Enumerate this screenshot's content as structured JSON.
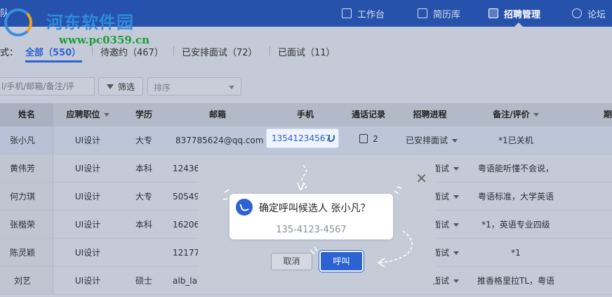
{
  "header": {
    "team_label": "队",
    "nav": [
      {
        "label": "工作台",
        "icon": "dashboard-icon",
        "active": false
      },
      {
        "label": "简历库",
        "icon": "resume-icon",
        "active": false
      },
      {
        "label": "招聘管理",
        "icon": "grid-icon",
        "active": true
      },
      {
        "label": "论坛",
        "icon": "chat-icon",
        "active": false
      }
    ]
  },
  "watermark": {
    "title": "河东软件园",
    "url": "www.pc0359.cn"
  },
  "filters": {
    "label": "式：",
    "tabs": [
      {
        "label": "全部（550）",
        "active": true
      },
      {
        "label": "待邀约（467）",
        "active": false
      },
      {
        "label": "已安排面试（72）",
        "active": false
      },
      {
        "label": "已面试（11）",
        "active": false
      }
    ],
    "search_placeholder": "l/手机/邮箱/备注/评",
    "filter_button": "筛选",
    "sort_placeholder": "排序"
  },
  "table": {
    "headers": {
      "name": "姓名",
      "position": "应聘职位",
      "education": "学历",
      "email": "邮箱",
      "phone": "手机",
      "calls": "通话记录",
      "progress": "招聘进程",
      "remark": "备注/评价",
      "extra": "期"
    },
    "rows": [
      {
        "name": "张小凡",
        "position": "UI设计",
        "education": "大专",
        "email": "837785624@qq.com",
        "phone": "13541234567",
        "calls": "2",
        "progress": "已安排面试",
        "remark": "*1已关机"
      },
      {
        "name": "黄伟芳",
        "position": "UI设计",
        "education": "本科",
        "email": "12436",
        "phone": "",
        "calls": "",
        "progress": "面试",
        "remark": "粤语能听懂不会说，"
      },
      {
        "name": "何力琪",
        "position": "UI设计",
        "education": "大专",
        "email": "50549",
        "phone": "",
        "calls": "",
        "progress": "面试",
        "remark": "粤语标准，大学英语"
      },
      {
        "name": "张楷荣",
        "position": "UI设计",
        "education": "本科",
        "email": "16206",
        "phone": "",
        "calls": "",
        "progress": "面试",
        "remark": "*1，英语专业四级"
      },
      {
        "name": "陈灵颖",
        "position": "UI设计",
        "education": "",
        "email": "12177",
        "phone": "",
        "calls": "",
        "progress": "面试",
        "remark": "*1"
      },
      {
        "name": "刘艺",
        "position": "UI设计",
        "education": "硕士",
        "email": "alb_la",
        "phone": "",
        "calls": "",
        "progress": "面试",
        "remark": "推香格里拉TL，粤语"
      }
    ]
  },
  "modal": {
    "question": "确定呼叫候选人  张小凡？",
    "phone": "135-4123-4567",
    "cancel_label": "取消",
    "call_label": "呼叫",
    "close_icon": "close-icon"
  },
  "colors": {
    "primary": "#2c62d2",
    "header": "#2f67d6",
    "overlay_bg": "#c4cad7"
  }
}
